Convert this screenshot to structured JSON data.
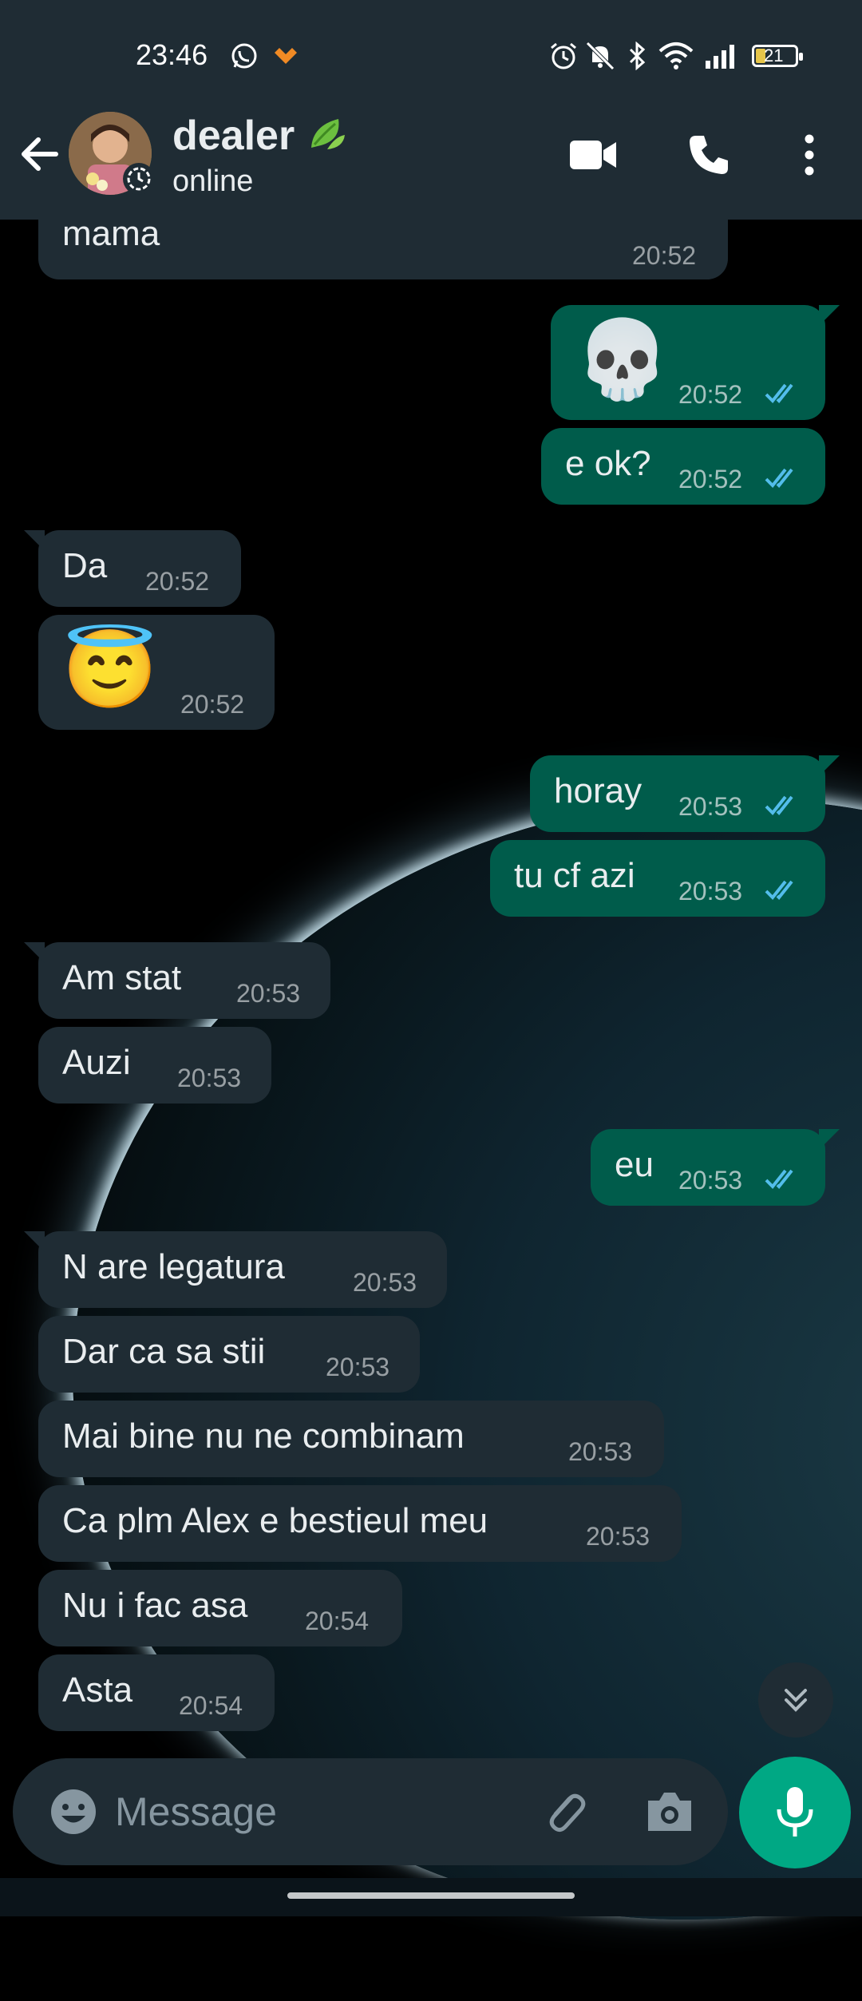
{
  "status_bar": {
    "time": "23:46",
    "battery": "21"
  },
  "header": {
    "contact_name": "dealer",
    "contact_status": "online",
    "back_label": "Back",
    "video_call_label": "Video call",
    "voice_call_label": "Voice call",
    "menu_label": "More options"
  },
  "messages": [
    {
      "dir": "in",
      "text": "mama",
      "time": "20:52"
    },
    {
      "dir": "out",
      "text": "💀",
      "time": "20:52"
    },
    {
      "dir": "out",
      "text": "e ok?",
      "time": "20:52"
    },
    {
      "dir": "in",
      "text": "Da",
      "time": "20:52"
    },
    {
      "dir": "in",
      "text": "😇",
      "time": "20:52"
    },
    {
      "dir": "out",
      "text": "horay",
      "time": "20:53"
    },
    {
      "dir": "out",
      "text": "tu cf azi",
      "time": "20:53"
    },
    {
      "dir": "in",
      "text": "Am stat",
      "time": "20:53"
    },
    {
      "dir": "in",
      "text": "Auzi",
      "time": "20:53"
    },
    {
      "dir": "out",
      "text": "eu",
      "time": "20:53"
    },
    {
      "dir": "in",
      "text": "N are legatura",
      "time": "20:53"
    },
    {
      "dir": "in",
      "text": "Dar ca sa stii",
      "time": "20:53"
    },
    {
      "dir": "in",
      "text": "Mai bine nu ne combinam",
      "time": "20:53"
    },
    {
      "dir": "in",
      "text": "Ca plm Alex e bestieul meu",
      "time": "20:53"
    },
    {
      "dir": "in",
      "text": "Nu i fac asa",
      "time": "20:54"
    },
    {
      "dir": "in",
      "text": "Asta",
      "time": "20:54"
    }
  ],
  "composer": {
    "placeholder": "Message"
  },
  "colors": {
    "header_bg": "#1f2c34",
    "incoming_bubble": "#1f2c34",
    "outgoing_bubble": "#005c4b",
    "accent": "#00a884",
    "read_ticks": "#53bdeb"
  }
}
